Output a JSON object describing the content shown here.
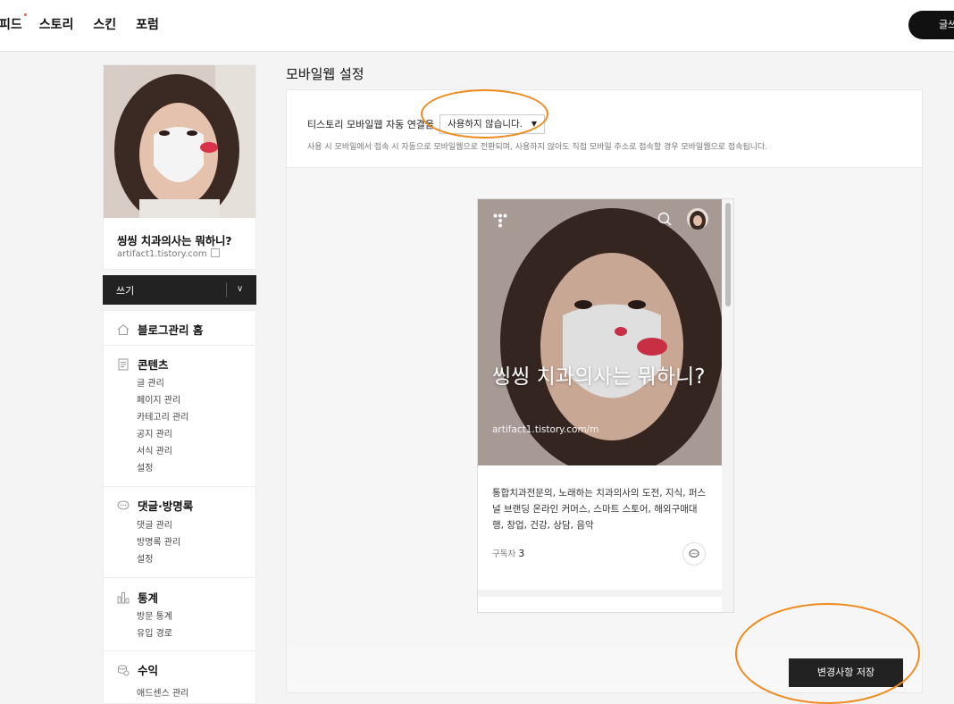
{
  "nav": {
    "items": [
      "피드",
      "스토리",
      "스킨",
      "포럼"
    ],
    "write_button": "글쓰기"
  },
  "sidebar": {
    "blog_title": "씽씽 치과의사는 뭐하니?",
    "blog_url": "artifact1.tistory.com",
    "write_label": "쓰기",
    "sections": [
      {
        "title": "블로그관리 홈",
        "icon": "home-icon",
        "items": []
      },
      {
        "title": "콘텐츠",
        "icon": "document-icon",
        "items": [
          "글 관리",
          "페이지 관리",
          "카테고리 관리",
          "공지 관리",
          "서식 관리",
          "설정"
        ]
      },
      {
        "title": "댓글·방명록",
        "icon": "speech-bubble-icon",
        "items": [
          "댓글 관리",
          "방명록 관리",
          "설정"
        ]
      },
      {
        "title": "통계",
        "icon": "bar-chart-icon",
        "items": [
          "방문 통계",
          "유입 경로"
        ]
      },
      {
        "title": "수익",
        "icon": "coins-icon",
        "items": [
          "애드센스 관리"
        ]
      }
    ]
  },
  "main": {
    "page_title": "모바일웹 설정",
    "setting_label": "티스토리 모바일웹 자동 연결을",
    "select_value": "사용하지 않습니다.",
    "description": "사용 시 모바일에서 접속 시 자동으로 모바일웹으로 전환되며, 사용하지 않아도 직접 모바일 주소로 접속할 경우 모바일웹으로 접속됩니다.",
    "preview": {
      "title": "씽씽 치과의사는 뭐하니?",
      "url": "artifact1.tistory.com/m",
      "description": "통합치과전문의, 노래하는 치과의사의 도전, 지식, 퍼스널 브랜딩 온라인 커머스, 스마트 스토어, 해외구매대행, 창업, 건강, 상담, 음악",
      "subscribers_label": "구독자",
      "subscribers_count": "3"
    },
    "save_button": "변경사항 저장"
  },
  "colors": {
    "annotation": "#ef8a1f",
    "dark_button": "#222222",
    "new_dot": "#ff5544"
  }
}
